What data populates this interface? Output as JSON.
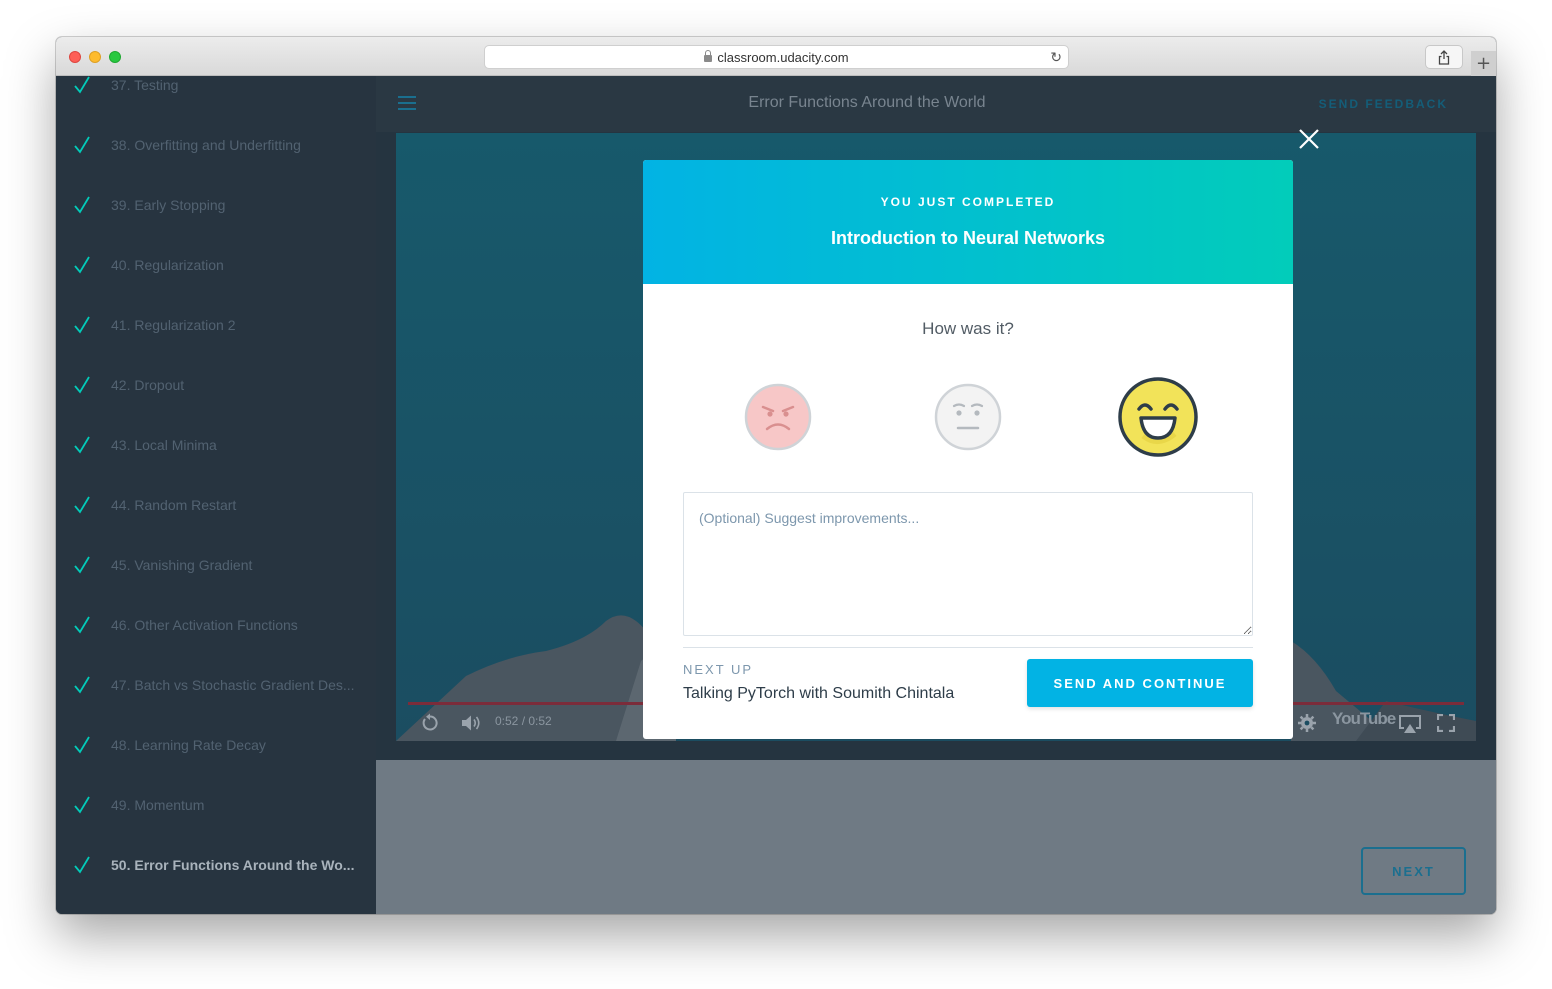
{
  "browser": {
    "url": "classroom.udacity.com"
  },
  "sidebar": {
    "items": [
      {
        "label": "37. Testing",
        "completed": true
      },
      {
        "label": "38. Overfitting and Underfitting",
        "completed": true
      },
      {
        "label": "39. Early Stopping",
        "completed": true
      },
      {
        "label": "40. Regularization",
        "completed": true
      },
      {
        "label": "41. Regularization 2",
        "completed": true
      },
      {
        "label": "42. Dropout",
        "completed": true
      },
      {
        "label": "43. Local Minima",
        "completed": true
      },
      {
        "label": "44. Random Restart",
        "completed": true
      },
      {
        "label": "45. Vanishing Gradient",
        "completed": true
      },
      {
        "label": "46. Other Activation Functions",
        "completed": true
      },
      {
        "label": "47. Batch vs Stochastic Gradient Des...",
        "completed": true
      },
      {
        "label": "48. Learning Rate Decay",
        "completed": true
      },
      {
        "label": "49. Momentum",
        "completed": true
      },
      {
        "label": "50. Error Functions Around the Wo...",
        "completed": true,
        "active": true
      }
    ]
  },
  "header": {
    "title": "Error Functions Around the World",
    "send_feedback": "SEND FEEDBACK"
  },
  "video": {
    "time": "0:52 / 0:52",
    "brand": "YouTube",
    "progress": 1.0
  },
  "footer": {
    "next_label": "NEXT"
  },
  "modal": {
    "completed_label": "YOU JUST COMPLETED",
    "lesson_title": "Introduction to Neural Networks",
    "question": "How was it?",
    "ratings": [
      "angry",
      "neutral",
      "happy"
    ],
    "selected_rating": "happy",
    "feedback_placeholder": "(Optional) Suggest improvements...",
    "feedback_value": "",
    "next_up_label": "NEXT UP",
    "next_up_title": "Talking PyTorch with Soumith Chintala",
    "continue_label": "SEND AND CONTINUE"
  },
  "colors": {
    "accent": "#02b3e4",
    "accent_end": "#02ccba",
    "check": "#02ccba",
    "sidebar_bg": "#273440",
    "selected_face": "#f2e359"
  }
}
